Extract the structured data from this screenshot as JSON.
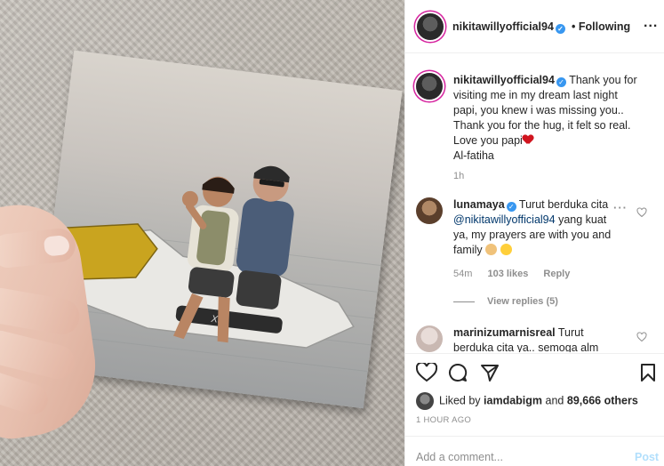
{
  "header": {
    "username": "nikitawillyofficial94",
    "separator": "•",
    "follow_status": "Following",
    "more": "..."
  },
  "caption": {
    "username": "nikitawillyofficial94",
    "lines": [
      "Thank you for",
      "visiting me in my dream last night",
      "papi, you knew i was missing you..",
      "Thank you for the hug, it felt so real.",
      "Love you papi",
      "Al-fatiha"
    ],
    "time": "1h"
  },
  "comments": [
    {
      "username": "lunamaya",
      "text_1": "Turut berduka cita",
      "mention": "@nikitawillyofficial94",
      "text_2": "yang kuat",
      "text_3": "ya, my prayers are with you and",
      "text_4": "family",
      "time": "54m",
      "likes": "103 likes",
      "reply": "Reply",
      "view_replies": "View replies (5)"
    },
    {
      "username": "marinizumarnisreal",
      "text_1": "Turut",
      "text_2": "berduka cita ya.. semoga alm"
    }
  ],
  "likes": {
    "prefix": "Liked by",
    "user": "iamdabigm",
    "and": "and",
    "others": "89,666 others"
  },
  "timestamp": "1 HOUR AGO",
  "add_comment": {
    "placeholder": "Add a comment...",
    "post_label": "Post"
  },
  "colors": {
    "verified": "#3897f0",
    "mention": "#00376b",
    "post_disabled": "#b2dffc",
    "heart": "#d0151f"
  },
  "icons": [
    "heart-icon",
    "comment-icon",
    "share-icon",
    "bookmark-icon",
    "verified-icon",
    "more-icon"
  ]
}
